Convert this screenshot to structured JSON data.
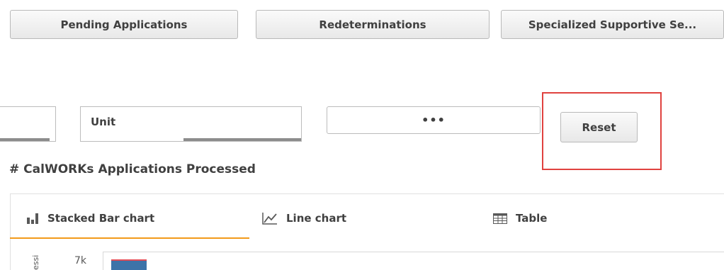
{
  "nav": {
    "buttons": [
      {
        "label": "Pending Applications"
      },
      {
        "label": "Redeterminations"
      },
      {
        "label": "Specialized Supportive Se..."
      }
    ]
  },
  "filters": {
    "unit_label": "Unit",
    "more_label": "•••",
    "reset_label": "Reset"
  },
  "section": {
    "title": "# CalWORKs Applications Processed"
  },
  "tabs": [
    {
      "label": "Stacked Bar chart",
      "icon": "bar-chart-icon",
      "active": true
    },
    {
      "label": "Line chart",
      "icon": "line-chart-icon",
      "active": false
    },
    {
      "label": "Table",
      "icon": "table-icon",
      "active": false
    }
  ],
  "chart": {
    "y_tick": "7k",
    "y_axis_title_fragment": "essi",
    "colors": {
      "bar_main": "#3d73a8",
      "bar_top": "#e24c56",
      "tab_active": "#f29a1a"
    }
  }
}
